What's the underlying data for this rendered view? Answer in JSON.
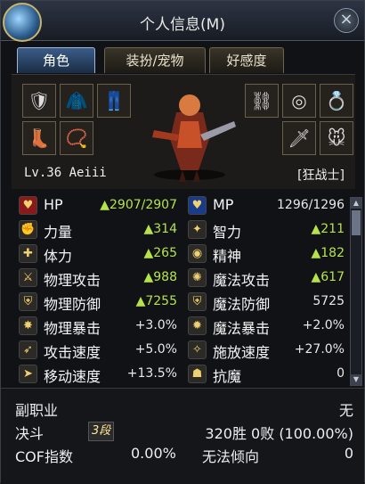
{
  "window": {
    "title": "个人信息(M)",
    "close_glyph": "×"
  },
  "tabs": [
    {
      "label": "角色"
    },
    {
      "label": "装扮/宠物"
    },
    {
      "label": "好感度"
    }
  ],
  "character": {
    "level_name": "Lv.36 Aeiii",
    "job": "[狂战士]"
  },
  "equipment_left": [
    "shoulder-armor-icon",
    "chest-armor-icon",
    "leg-armor-icon",
    "boots-icon",
    "necklace-icon"
  ],
  "equipment_right": [
    "ring-chain-icon",
    "bracelet-icon",
    "ring-icon",
    "sword-icon",
    "pet-icon"
  ],
  "stats": {
    "left": [
      {
        "label": "HP",
        "value": "▲2907/2907",
        "color": "green",
        "icon": "heart-icon"
      },
      {
        "label": "力量",
        "value": "▲314",
        "color": "green",
        "icon": "strength-icon"
      },
      {
        "label": "体力",
        "value": "▲265",
        "color": "green",
        "icon": "stamina-icon"
      },
      {
        "label": "物理攻击",
        "value": "▲988",
        "color": "green",
        "icon": "physical-attack-icon"
      },
      {
        "label": "物理防御",
        "value": "▲7255",
        "color": "green",
        "icon": "physical-defense-icon"
      },
      {
        "label": "物理暴击",
        "value": "+3.0%",
        "color": "white",
        "icon": "physical-crit-icon"
      },
      {
        "label": "攻击速度",
        "value": "+5.0%",
        "color": "white",
        "icon": "attack-speed-icon"
      },
      {
        "label": "移动速度",
        "value": "+13.5%",
        "color": "white",
        "icon": "move-speed-icon"
      }
    ],
    "right": [
      {
        "label": "MP",
        "value": "1296/1296",
        "color": "white",
        "icon": "mana-heart-icon"
      },
      {
        "label": "智力",
        "value": "▲211",
        "color": "green",
        "icon": "intelligence-icon"
      },
      {
        "label": "精神",
        "value": "▲182",
        "color": "green",
        "icon": "spirit-icon"
      },
      {
        "label": "魔法攻击",
        "value": "▲617",
        "color": "green",
        "icon": "magic-attack-icon"
      },
      {
        "label": "魔法防御",
        "value": "5725",
        "color": "white",
        "icon": "magic-defense-icon"
      },
      {
        "label": "魔法暴击",
        "value": "+2.0%",
        "color": "white",
        "icon": "magic-crit-icon"
      },
      {
        "label": "施放速度",
        "value": "+27.0%",
        "color": "white",
        "icon": "cast-speed-icon"
      },
      {
        "label": "抗魔",
        "value": "0",
        "color": "white",
        "icon": "anti-magic-icon"
      }
    ]
  },
  "scrollbar": {
    "up": "▲",
    "down": "▼"
  },
  "bottom": {
    "subjob_label": "副职业",
    "subjob_value": "无",
    "duel_label": "决斗",
    "duel_rank": "3段",
    "duel_record": "320胜 0败 (100.00%)",
    "cof_label": "COF指数",
    "cof_value": "0.00%",
    "tendency_label": "无法倾向",
    "tendency_value": "0"
  },
  "colors": {
    "green": "#b6e34a",
    "white": "#e8e8e8",
    "accent": "#3b5c88"
  }
}
